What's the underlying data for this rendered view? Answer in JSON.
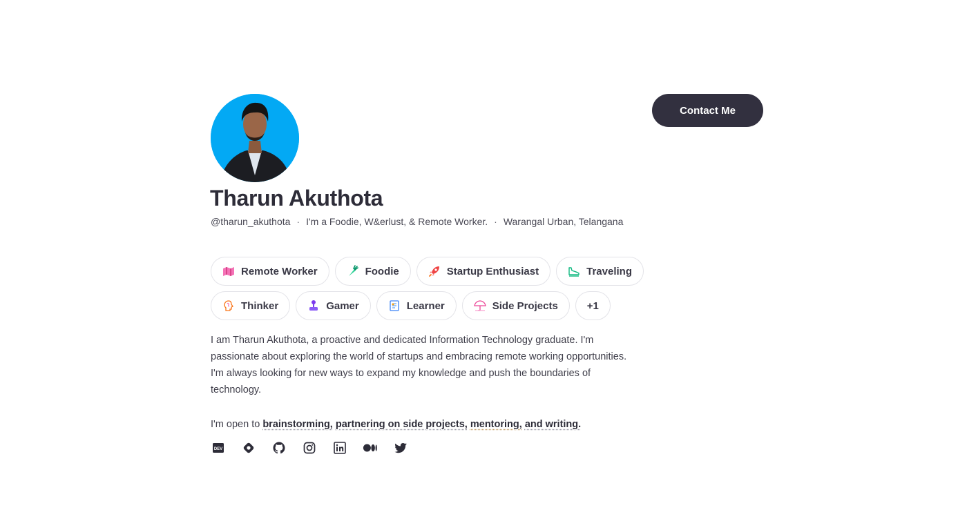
{
  "profile": {
    "name": "Tharun Akuthota",
    "handle": "@tharun_akuthota",
    "tagline": "I'm a Foodie, W&erlust, & Remote Worker.",
    "location": "Warangal Urban, Telangana",
    "separator": "·"
  },
  "contact_button": {
    "label": "Contact Me"
  },
  "tags_row1": [
    {
      "label": "Remote Worker",
      "icon": "map-icon"
    },
    {
      "label": "Foodie",
      "icon": "carrot-icon"
    },
    {
      "label": "Startup Enthusiast",
      "icon": "rocket-icon"
    },
    {
      "label": "Traveling",
      "icon": "shoe-icon"
    }
  ],
  "tags_row2": [
    {
      "label": "Thinker",
      "icon": "brain-icon"
    },
    {
      "label": "Gamer",
      "icon": "joystick-icon"
    },
    {
      "label": "Learner",
      "icon": "book-icon"
    },
    {
      "label": "Side Projects",
      "icon": "umbrella-icon"
    },
    {
      "label": "+1"
    }
  ],
  "bio": "I am Tharun Akuthota, a proactive and dedicated Information Technology graduate. I'm passionate about exploring the world of startups and embracing remote working opportunities. I'm always looking for new ways to expand my knowledge and push the boundaries of technology.",
  "open_to": {
    "prefix": "I'm open to",
    "item1": "brainstorming,",
    "item2": "partnering on side projects,",
    "item3": "mentoring,",
    "item4": "and writing."
  },
  "socials": [
    "dev-icon",
    "hashnode-icon",
    "github-icon",
    "instagram-icon",
    "linkedin-icon",
    "medium-icon",
    "twitter-icon"
  ],
  "colors": {
    "accent_dark": "#32303f",
    "avatar_bg": "#03a9f4"
  }
}
